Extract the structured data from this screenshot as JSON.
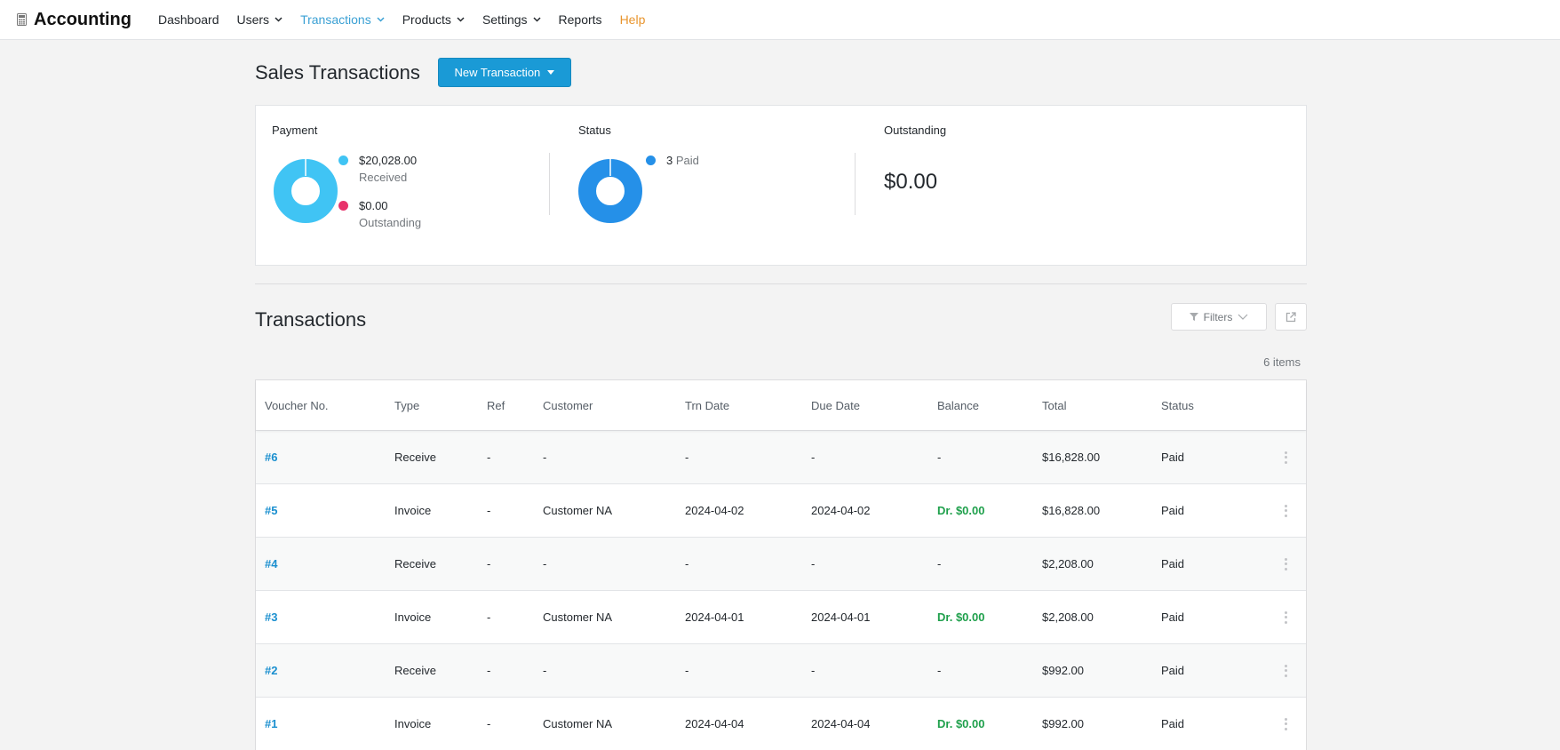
{
  "app": {
    "title": "Accounting"
  },
  "nav": {
    "items": [
      {
        "label": "Dashboard",
        "dropdown": false,
        "active": false
      },
      {
        "label": "Users",
        "dropdown": true,
        "active": false
      },
      {
        "label": "Transactions",
        "dropdown": true,
        "active": true
      },
      {
        "label": "Products",
        "dropdown": true,
        "active": false
      },
      {
        "label": "Settings",
        "dropdown": true,
        "active": false
      },
      {
        "label": "Reports",
        "dropdown": false,
        "active": false
      },
      {
        "label": "Help",
        "dropdown": false,
        "active": false
      }
    ]
  },
  "header": {
    "title": "Sales Transactions",
    "new_button_label": "New Transaction"
  },
  "summary": {
    "payment": {
      "label": "Payment",
      "received_value": "$20,028.00",
      "received_label": "Received",
      "outstanding_value": "$0.00",
      "outstanding_label": "Outstanding",
      "received_color": "#40c4f4",
      "outstanding_color": "#e8336b"
    },
    "status": {
      "label": "Status",
      "paid_count": "3",
      "paid_label": "Paid",
      "paid_color": "#2590e8"
    },
    "outstanding": {
      "label": "Outstanding",
      "amount": "$0.00"
    }
  },
  "transactions": {
    "title": "Transactions",
    "filters_label": "Filters",
    "items_count": "6 items",
    "columns": {
      "voucher": "Voucher No.",
      "type": "Type",
      "ref": "Ref",
      "customer": "Customer",
      "trn_date": "Trn Date",
      "due_date": "Due Date",
      "balance": "Balance",
      "total": "Total",
      "status": "Status"
    },
    "rows": [
      {
        "voucher": "#6",
        "type": "Receive",
        "ref": "-",
        "customer": "-",
        "trn_date": "-",
        "due_date": "-",
        "balance": "-",
        "total": "$16,828.00",
        "status": "Paid"
      },
      {
        "voucher": "#5",
        "type": "Invoice",
        "ref": "-",
        "customer": "Customer NA",
        "trn_date": "2024-04-02",
        "due_date": "2024-04-02",
        "balance": "Dr. $0.00",
        "total": "$16,828.00",
        "status": "Paid"
      },
      {
        "voucher": "#4",
        "type": "Receive",
        "ref": "-",
        "customer": "-",
        "trn_date": "-",
        "due_date": "-",
        "balance": "-",
        "total": "$2,208.00",
        "status": "Paid"
      },
      {
        "voucher": "#3",
        "type": "Invoice",
        "ref": "-",
        "customer": "Customer NA",
        "trn_date": "2024-04-01",
        "due_date": "2024-04-01",
        "balance": "Dr. $0.00",
        "total": "$2,208.00",
        "status": "Paid"
      },
      {
        "voucher": "#2",
        "type": "Receive",
        "ref": "-",
        "customer": "-",
        "trn_date": "-",
        "due_date": "-",
        "balance": "-",
        "total": "$992.00",
        "status": "Paid"
      },
      {
        "voucher": "#1",
        "type": "Invoice",
        "ref": "-",
        "customer": "Customer NA",
        "trn_date": "2024-04-04",
        "due_date": "2024-04-04",
        "balance": "Dr. $0.00",
        "total": "$992.00",
        "status": "Paid"
      }
    ]
  }
}
